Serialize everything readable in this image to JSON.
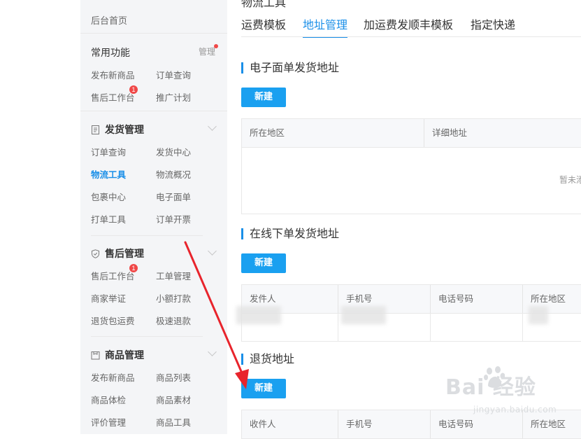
{
  "sidebar": {
    "home": "后台首页",
    "common": {
      "title": "常用功能",
      "manage": "管理",
      "items": [
        "发布新商品",
        "订单查询",
        "售后工作台",
        "推广计划"
      ],
      "badge": "1"
    },
    "shipping": {
      "title": "发货管理",
      "icon": "document-icon",
      "items": [
        "订单查询",
        "发货中心",
        "物流工具",
        "物流概况",
        "包裹中心",
        "电子面单",
        "打单工具",
        "订单开票"
      ],
      "active": "物流工具"
    },
    "aftersale": {
      "title": "售后管理",
      "icon": "shield-check-icon",
      "items": [
        "售后工作台",
        "工单管理",
        "商家举证",
        "小额打款",
        "退货包运费",
        "极速退款"
      ],
      "badge": "1"
    },
    "goods": {
      "title": "商品管理",
      "icon": "goods-box-icon",
      "items": [
        "发布新商品",
        "商品列表",
        "商品体检",
        "商品素材",
        "评价管理",
        "商品工具"
      ]
    }
  },
  "main": {
    "cut_title": "物流工具",
    "tabs": [
      "运费模板",
      "地址管理",
      "加运费发顺丰模板",
      "指定快递"
    ],
    "active_tab": "地址管理",
    "section1": {
      "title": "电子面单发货地址",
      "button": "新建",
      "columns": [
        "所在地区",
        "详细地址"
      ],
      "empty": "暂未添"
    },
    "section2": {
      "title": "在线下单发货地址",
      "button": "新建",
      "columns": [
        "发件人",
        "手机号",
        "电话号码",
        "所在地区"
      ]
    },
    "section3": {
      "title": "退货地址",
      "button": "新建",
      "columns": [
        "收件人",
        "手机号",
        "电话号码",
        "所在地区"
      ]
    }
  },
  "colors": {
    "accent": "#1a8fe8",
    "button": "#1aa0f0",
    "badge": "#f04848",
    "arrow": "#e8242c"
  },
  "watermark": {
    "main": "Bai  经验",
    "sub": "jingyan.baidu.com"
  }
}
